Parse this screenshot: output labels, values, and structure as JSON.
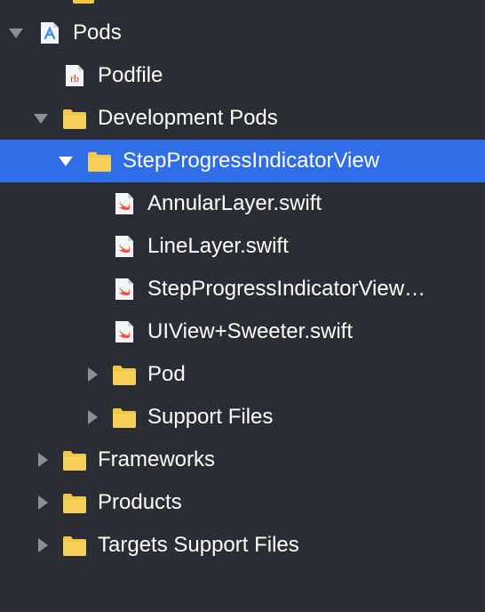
{
  "tree": {
    "items": [
      {
        "label": "Pods",
        "icon": "xcode-project-icon",
        "disclosure": "expanded",
        "selected": false
      },
      {
        "label": "Podfile",
        "icon": "ruby-file-icon",
        "icon_text": "rb",
        "disclosure": "none",
        "selected": false
      },
      {
        "label": "Development Pods",
        "icon": "folder-icon",
        "disclosure": "expanded",
        "selected": false
      },
      {
        "label": "StepProgressIndicatorView",
        "icon": "folder-icon",
        "disclosure": "expanded",
        "selected": true
      },
      {
        "label": "AnnularLayer.swift",
        "icon": "swift-file-icon",
        "disclosure": "none",
        "selected": false
      },
      {
        "label": "LineLayer.swift",
        "icon": "swift-file-icon",
        "disclosure": "none",
        "selected": false
      },
      {
        "label": "StepProgressIndicatorView…",
        "icon": "swift-file-icon",
        "disclosure": "none",
        "selected": false
      },
      {
        "label": "UIView+Sweeter.swift",
        "icon": "swift-file-icon",
        "disclosure": "none",
        "selected": false
      },
      {
        "label": "Pod",
        "icon": "folder-icon",
        "disclosure": "collapsed",
        "selected": false
      },
      {
        "label": "Support Files",
        "icon": "folder-icon",
        "disclosure": "collapsed",
        "selected": false
      },
      {
        "label": "Frameworks",
        "icon": "folder-icon",
        "disclosure": "collapsed",
        "selected": false
      },
      {
        "label": "Products",
        "icon": "folder-icon",
        "disclosure": "collapsed",
        "selected": false
      },
      {
        "label": "Targets Support Files",
        "icon": "folder-icon",
        "disclosure": "collapsed",
        "selected": false
      }
    ]
  },
  "colors": {
    "background": "#2b2d34",
    "selection": "#2f6ee6",
    "folder": "#f5c644",
    "text": "#ffffff",
    "disclosure": "#8e9099",
    "swift": "#f05138",
    "ruby": "#cc342d"
  }
}
